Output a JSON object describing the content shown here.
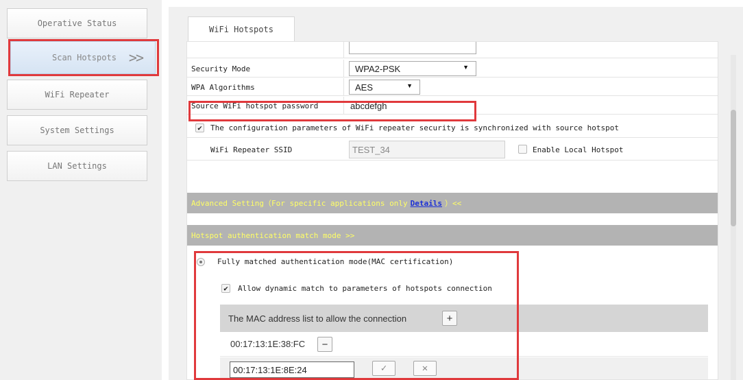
{
  "sidebar": {
    "items": [
      {
        "label": "Operative Status"
      },
      {
        "label": "Scan Hotspots",
        "chevron": ">>"
      },
      {
        "label": "WiFi Repeater"
      },
      {
        "label": "System Settings"
      },
      {
        "label": "LAN Settings"
      }
    ],
    "active_index": 1
  },
  "main": {
    "tab_label": "WiFi Hotspots",
    "security_mode": {
      "label": "Security Mode",
      "value": "WPA2-PSK"
    },
    "wpa_algorithms": {
      "label": "WPA Algorithms",
      "value": "AES"
    },
    "source_password": {
      "label": "Source WiFi hotspot password",
      "value": "abcdefgh"
    },
    "sync_checkbox": {
      "label": "The configuration parameters of WiFi repeater security is synchronized with source hotspot",
      "checked": true
    },
    "repeater_ssid": {
      "label": "WiFi Repeater SSID",
      "value": "TEST_34"
    },
    "enable_local_hotspot": {
      "label": "Enable Local Hotspot",
      "checked": false
    },
    "advanced_bar": {
      "prefix": "Advanced Setting（For specific applications only",
      "link": "Details",
      "suffix": "）<<"
    },
    "auth_bar": {
      "label": "Hotspot authentication match mode >>"
    },
    "auth_mode": {
      "label": "Fully matched authentication mode(MAC certification)",
      "selected": true
    },
    "dynamic_match": {
      "label": "Allow dynamic match to parameters of hotspots connection",
      "checked": true
    },
    "mac_list": {
      "header": "The MAC address list to allow the connection",
      "add_label": "+",
      "entries": [
        {
          "mac": "00:17:13:1E:38:FC",
          "remove_label": "−"
        }
      ],
      "new_entry_value": "00:17:13:1E:8E:24",
      "confirm_label": "✓",
      "cancel_label": "✕"
    }
  },
  "colors": {
    "highlight_red": "#e0393c",
    "bar_gray": "#b3b3b3",
    "bar_text_yellow": "#ffff66",
    "link_blue": "#1a2fd6"
  }
}
